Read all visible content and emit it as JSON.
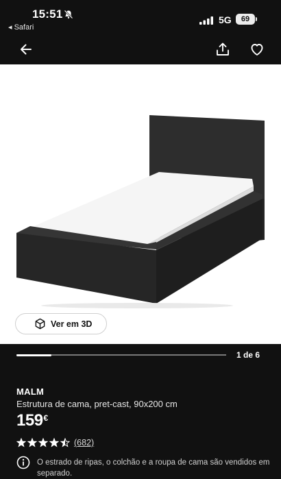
{
  "status": {
    "time": "15:51",
    "back_app": "◂ Safari",
    "network": "5G",
    "battery": "69"
  },
  "icons": {
    "back": "arrow-left-icon",
    "share": "share-icon",
    "favorite": "heart-icon",
    "view3d": "cube-icon",
    "info": "info-icon",
    "bell": "bell-slash-icon"
  },
  "gallery": {
    "view3d_label": "Ver em 3D",
    "page_indicator": "1 de 6",
    "progress": 0.166
  },
  "product": {
    "name": "MALM",
    "description": "Estrutura de cama, pret-cast, 90x200 cm",
    "price": "159",
    "currency": "€",
    "rating": 4.5,
    "reviews": "(682)",
    "notice": "O estrado de ripas, o colchão e a roupa de cama são vendidos em separado."
  },
  "colors": {
    "background": "#111111",
    "text": "#ffffff",
    "image_bg": "#ffffff",
    "bed_frame": "#2b2b2b",
    "mattress": "#f4f4f4"
  }
}
